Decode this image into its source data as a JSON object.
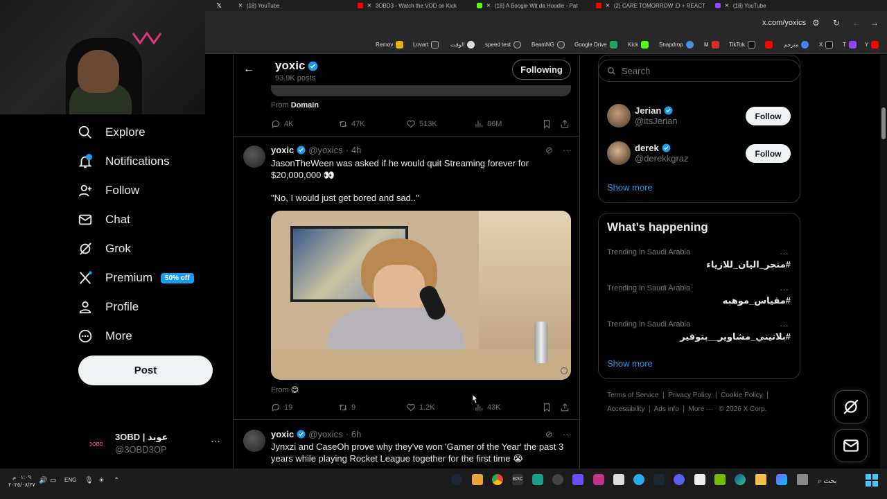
{
  "browser": {
    "tabs": [
      {
        "title": "(18) YouTube",
        "color": "#ff0000"
      },
      {
        "title": "3OBD3 - Watch the VOD on Kick",
        "color": "#53fc18"
      },
      {
        "title": "(18) A Boogie Wit da Hoodie - Pat",
        "color": "#ff0000"
      },
      {
        "title": "(2) CARE TOMORROW :D + REACT",
        "color": "#9146ff"
      },
      {
        "title": "(18) YouTube",
        "color": "#ff0000"
      }
    ],
    "url": "x.com/yoxics",
    "bookmarks": [
      {
        "label": "Remov",
        "color": "#e8b300"
      },
      {
        "label": "Lovart",
        "color": "#ffffff"
      },
      {
        "label": "الوقت",
        "color": "#ffffff"
      },
      {
        "label": "speed test",
        "color": "#ffffff"
      },
      {
        "label": "BeamNG",
        "color": "#ffffff"
      },
      {
        "label": "Google Drive",
        "color": "#1fa463"
      },
      {
        "label": "Kick",
        "color": "#53fc18"
      },
      {
        "label": "Snapdrop",
        "color": "#4a90e2"
      },
      {
        "label": "M",
        "color": "#d93025"
      },
      {
        "label": "TikTok",
        "color": "#ffffff"
      },
      {
        "label": "مترجم",
        "color": "#4285f4"
      },
      {
        "label": "X",
        "color": "#ffffff"
      },
      {
        "label": "T",
        "color": "#9146ff"
      },
      {
        "label": "Y",
        "color": "#ff0000"
      }
    ]
  },
  "nav": {
    "items": [
      {
        "label": "Explore",
        "icon": "search-icon"
      },
      {
        "label": "Notifications",
        "icon": "bell-icon",
        "badge": "1"
      },
      {
        "label": "Follow",
        "icon": "person-add-icon"
      },
      {
        "label": "Chat",
        "icon": "mail-icon"
      },
      {
        "label": "Grok",
        "icon": "grok-icon"
      },
      {
        "label": "Premium",
        "icon": "x-logo-icon",
        "tag": "50% off"
      },
      {
        "label": "Profile",
        "icon": "person-icon"
      },
      {
        "label": "More",
        "icon": "more-circle-icon"
      }
    ],
    "post_label": "Post",
    "account": {
      "name": "3OBD | عوبد",
      "handle": "@3OBD3OP",
      "avatar_text": "3OBD"
    }
  },
  "profile_header": {
    "name": "yoxic",
    "posts_count": "93.9K posts",
    "following_label": "Following"
  },
  "tweets": [
    {
      "from_label": "From",
      "from_source": "Domain",
      "stats": {
        "replies": "4K",
        "retweets": "47K",
        "likes": "513K",
        "views": "86M"
      }
    },
    {
      "name": "yoxic",
      "handle": "@yoxics",
      "time": "4h",
      "text_line1": "JasonTheWeen was asked if he would quit Streaming forever for",
      "text_line2": "$20,000,000 👀",
      "text_line3": "\"No, I would just get bored and sad..\"",
      "from_label": "From",
      "from_source": "😊",
      "stats": {
        "replies": "19",
        "retweets": "9",
        "likes": "1.2K",
        "views": "43K"
      }
    },
    {
      "name": "yoxic",
      "handle": "@yoxics",
      "time": "6h",
      "text_line1": "Jynxzi and CaseOh prove why they've won 'Gamer of the Year' the past 3",
      "text_line2": "years while playing Rocket League together for the first time 😭"
    }
  ],
  "sidebar": {
    "search_placeholder": "Search",
    "who_to_follow": [
      {
        "name": "Jerian",
        "handle": "@itsJerian",
        "button": "Follow"
      },
      {
        "name": "derek",
        "handle": "@derekkgraz",
        "button": "Follow"
      }
    ],
    "show_more": "Show more",
    "happening_title": "What’s happening",
    "trends": [
      {
        "context": "Trending in Saudi Arabia",
        "tag": "#متجر_اليان_للازياء"
      },
      {
        "context": "Trending in Saudi Arabia",
        "tag": "#مقياس_موهبه"
      },
      {
        "context": "Trending in Saudi Arabia",
        "tag": "#بلاتيني_مشاوير__بتوفير"
      }
    ],
    "show_more_2": "Show more",
    "footer_links": [
      "Terms of Service",
      "Privacy Policy",
      "Cookie Policy",
      "Accessibility",
      "Ads info",
      "More ···",
      "© 2026 X Corp."
    ]
  },
  "taskbar": {
    "time": "٠١:٠٩ م",
    "date": "٢٠٢٥/٠٨/٢٧",
    "lang": "ENG",
    "search_label": "بحث"
  },
  "colors": {
    "accent": "#1d9bf0",
    "background": "#000000",
    "text": "#e7e9ea",
    "muted": "#71767b"
  }
}
